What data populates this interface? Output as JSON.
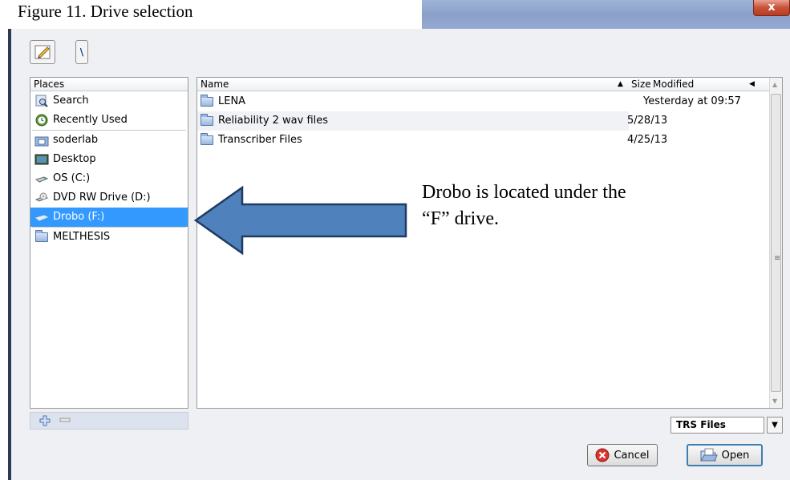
{
  "caption": "Figure 11. Drive selection",
  "window": {
    "close_label": "x"
  },
  "toolbar": {
    "path_label": "\\"
  },
  "places": {
    "header": "Places",
    "items": [
      {
        "label": "Search",
        "icon": "search-icon"
      },
      {
        "label": "Recently Used",
        "icon": "recent-icon"
      },
      {
        "label": "soderlab",
        "icon": "home-folder-icon"
      },
      {
        "label": "Desktop",
        "icon": "desktop-icon"
      },
      {
        "label": "OS (C:)",
        "icon": "hard-drive-icon"
      },
      {
        "label": "DVD RW Drive (D:)",
        "icon": "dvd-drive-icon"
      },
      {
        "label": "Drobo (F:)",
        "icon": "drive-icon",
        "selected": true
      },
      {
        "label": "MELTHESIS",
        "icon": "folder-icon"
      }
    ]
  },
  "files": {
    "columns": {
      "name": "Name",
      "size": "Size",
      "modified": "Modified"
    },
    "rows": [
      {
        "name": "LENA",
        "modified": "Yesterday at 09:57"
      },
      {
        "name": "Reliability 2 wav files",
        "modified": "5/28/13"
      },
      {
        "name": "Transcriber Files",
        "modified": "4/25/13"
      }
    ]
  },
  "filter": {
    "value": "TRS Files"
  },
  "buttons": {
    "cancel": "Cancel",
    "open": "Open"
  },
  "annotation": {
    "line1": "Drobo is located under the",
    "line2": "“F” drive."
  },
  "colors": {
    "selection": "#3399ff",
    "arrow_fill": "#4f81bd",
    "arrow_stroke": "#1f3b63"
  }
}
